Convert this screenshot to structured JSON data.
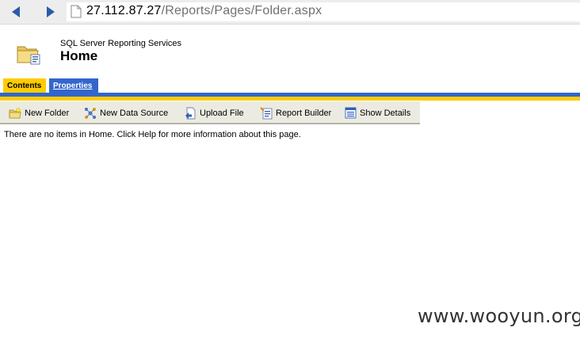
{
  "browser": {
    "url_host": "27.112.87.27",
    "url_path": "/Reports/Pages/Folder.aspx"
  },
  "header": {
    "subtitle": "SQL Server Reporting Services",
    "title": "Home"
  },
  "tabs": [
    {
      "label": "Contents",
      "active": true
    },
    {
      "label": "Properties",
      "active": false
    }
  ],
  "toolbar": {
    "new_folder": "New Folder",
    "new_data_source": "New Data Source",
    "upload_file": "Upload File",
    "report_builder": "Report Builder",
    "show_details": "Show Details"
  },
  "content": {
    "empty_message": "There are no items in Home. Click Help for more information about this page."
  },
  "watermark": "www.wooyun.org",
  "colors": {
    "tab_active": "#ffcc00",
    "tab_inactive": "#3366cc",
    "toolbar_bg": "#ecebe2"
  }
}
